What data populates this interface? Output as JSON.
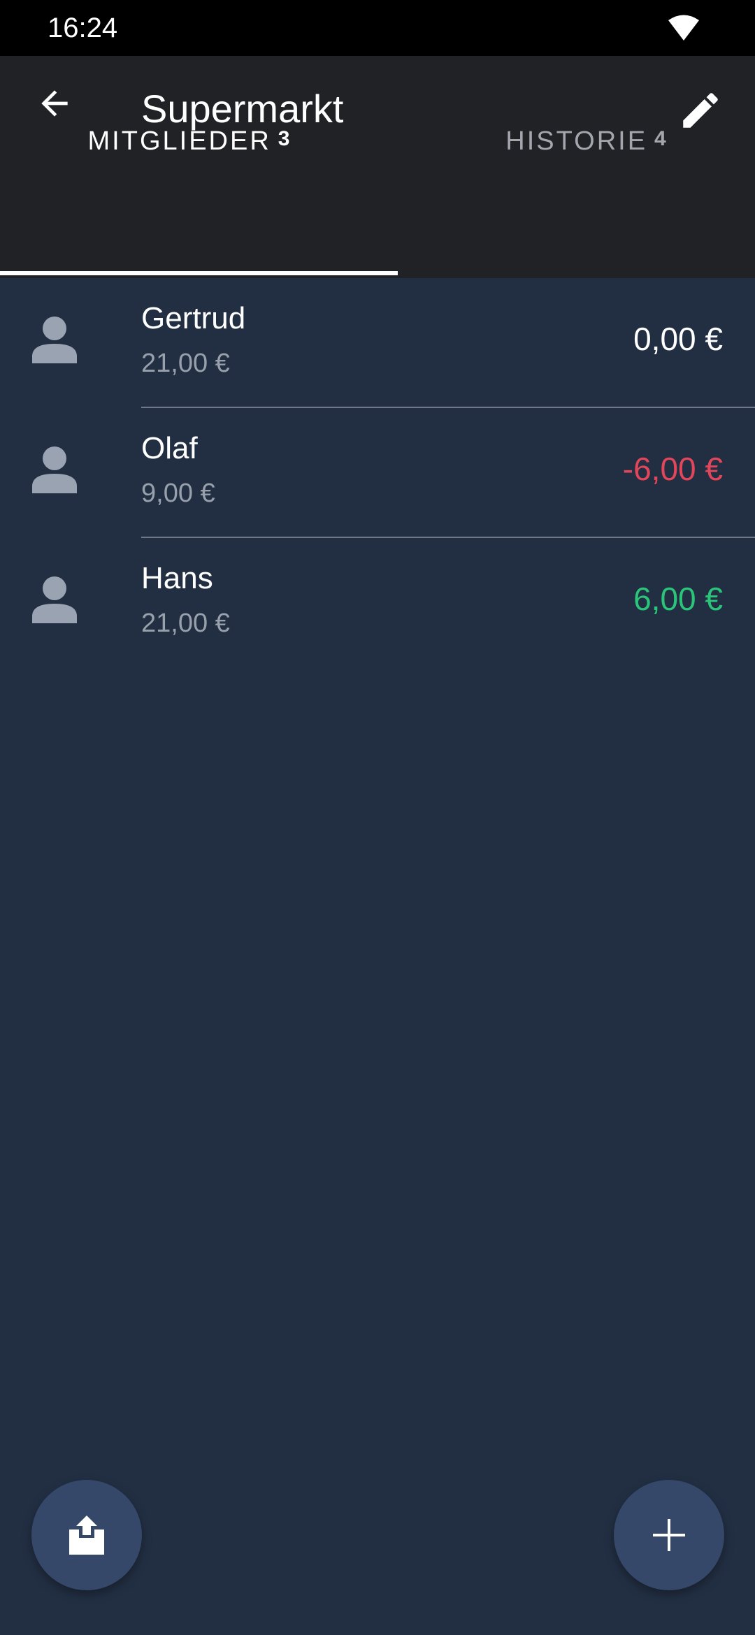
{
  "status_bar": {
    "time": "16:24",
    "wifi_icon": "wifi-icon"
  },
  "app_bar": {
    "title": "Supermarkt",
    "back_icon": "arrow-back-icon",
    "edit_icon": "pencil-icon"
  },
  "tabs": [
    {
      "label": "MITGLIEDER",
      "count": "3",
      "selected": true
    },
    {
      "label": "HISTORIE",
      "count": "4",
      "selected": false
    }
  ],
  "members": [
    {
      "name": "Gertrud",
      "paid": "21,00 €",
      "balance": "0,00 €",
      "balance_color": "#ffffff"
    },
    {
      "name": "Olaf",
      "paid": "9,00 €",
      "balance": "-6,00 €",
      "balance_color": "#e2465a"
    },
    {
      "name": "Hans",
      "paid": "21,00 €",
      "balance": "6,00 €",
      "balance_color": "#2bc57a"
    }
  ],
  "fabs": {
    "share_icon": "share-upload-icon",
    "add_icon": "plus-icon"
  },
  "colors": {
    "background": "#222f43",
    "app_bar": "#212226",
    "fab": "#35486a",
    "negative": "#e2465a",
    "positive": "#2bc57a"
  }
}
